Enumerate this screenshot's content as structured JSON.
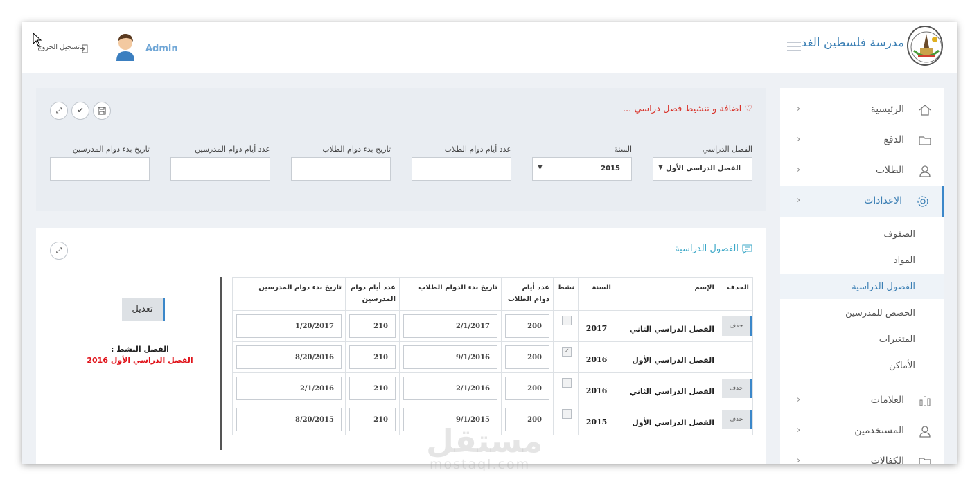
{
  "header": {
    "school_name": "مدرسة فلسطين الغد",
    "user_name": "Admin",
    "logout_label": "تسجيل الخروج"
  },
  "sidebar": {
    "items": [
      {
        "label": "الرئيسية",
        "icon": "home-icon"
      },
      {
        "label": "الدفع",
        "icon": "folder-icon"
      },
      {
        "label": "الطلاب",
        "icon": "user-icon"
      },
      {
        "label": "الاعدادات",
        "icon": "gear-icon",
        "active": true
      },
      {
        "label": "العلامات",
        "icon": "bar-chart-icon"
      },
      {
        "label": "المستخدمين",
        "icon": "users-icon"
      },
      {
        "label": "الكفالات",
        "icon": "folder-icon"
      }
    ],
    "sub_items": [
      "الصفوف",
      "المواد",
      "الفصول الدراسية",
      "الحصص للمدرسين",
      "المتغيرات",
      "الأماكن"
    ],
    "current_sub": "الفصول الدراسية"
  },
  "form": {
    "title": "اضافة و تنشيط فصل دراسي ...",
    "fields": {
      "semester": {
        "label": "الفصل الدراسي",
        "value": "الفصل الدراسي الأول"
      },
      "year": {
        "label": "السنة",
        "value": "2015"
      },
      "student_days": {
        "label": "عدد أيام دوام الطلاب",
        "value": ""
      },
      "student_start": {
        "label": "تاريخ بدء دوام الطلاب",
        "value": ""
      },
      "teacher_days": {
        "label": "عدد أيام دوام المدرسين",
        "value": ""
      },
      "teacher_start": {
        "label": "تاريخ بدء دوام المدرسين",
        "value": ""
      }
    }
  },
  "table": {
    "title": "الفصول الدراسية",
    "headers": {
      "delete": "الحذف",
      "name": "الإسم",
      "year": "السنة",
      "active": "نشط",
      "student_days": "عدد أيام دوام الطلاب",
      "student_start": "تاريخ بدء الدوام الطلاب",
      "teacher_days": "عدد أيام دوام المدرسين",
      "teacher_start": "تاريخ بدء دوام المدرسين"
    },
    "delete_label": "حذف",
    "rows": [
      {
        "name": "الفصل الدراسي الثاني",
        "year": "2017",
        "active": false,
        "student_days": "200",
        "student_start": "2/1/2017",
        "teacher_days": "210",
        "teacher_start": "1/20/2017",
        "deletable": true
      },
      {
        "name": "الفصل الدراسي الأول",
        "year": "2016",
        "active": true,
        "student_days": "200",
        "student_start": "9/1/2016",
        "teacher_days": "210",
        "teacher_start": "8/20/2016",
        "deletable": false
      },
      {
        "name": "الفصل الدراسي الثاني",
        "year": "2016",
        "active": false,
        "student_days": "200",
        "student_start": "2/1/2016",
        "teacher_days": "210",
        "teacher_start": "2/1/2016",
        "deletable": true
      },
      {
        "name": "الفصل الدراسي الأول",
        "year": "2015",
        "active": false,
        "student_days": "200",
        "student_start": "9/1/2015",
        "teacher_days": "210",
        "teacher_start": "8/20/2015",
        "deletable": true
      }
    ]
  },
  "side_panel": {
    "edit_label": "تعديل",
    "active_label": "الفصل النشط :",
    "active_value": "الفصل الدراسي الأول 2016"
  },
  "watermark": {
    "text": "مستقل",
    "sub": "mostaql.com"
  },
  "colors": {
    "accent": "#3b87c9",
    "title_red": "#d9342b",
    "active_red": "#e0131a",
    "teal": "#3aa7c7"
  }
}
